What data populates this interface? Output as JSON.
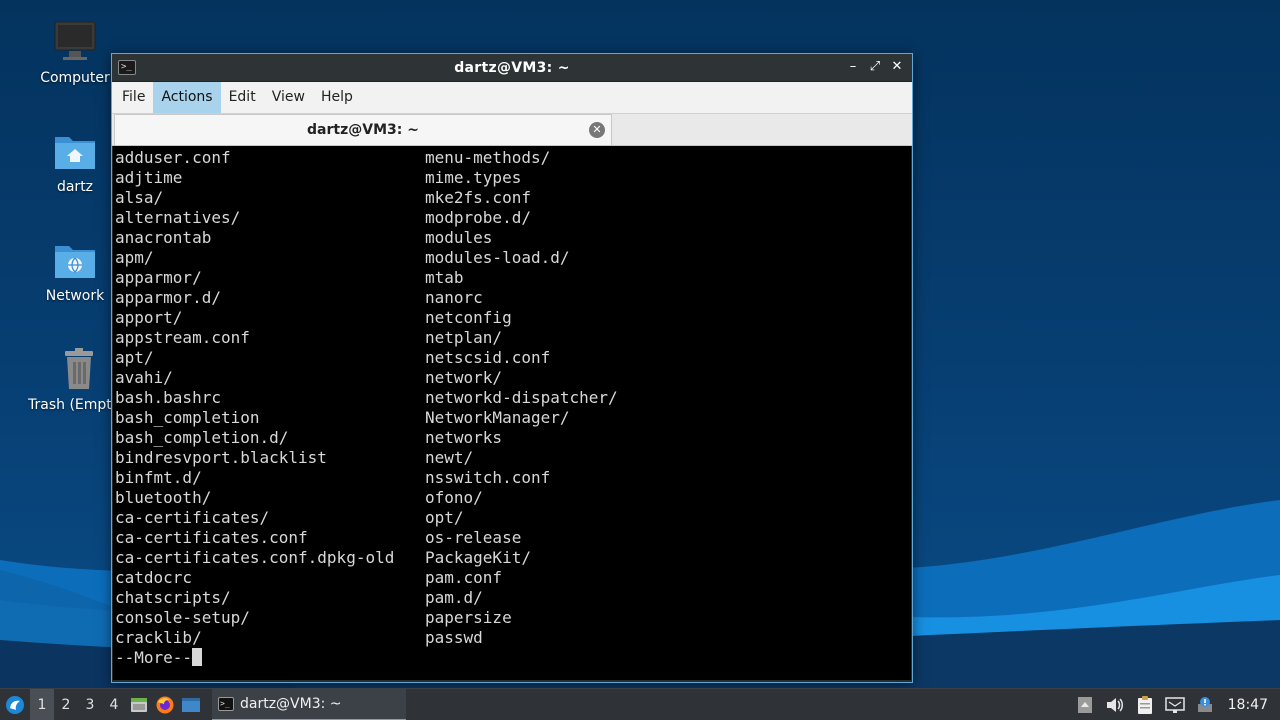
{
  "desktop": {
    "icons": [
      {
        "label": "Computer",
        "icon": "computer-icon"
      },
      {
        "label": "dartz",
        "icon": "home-folder-icon"
      },
      {
        "label": "Network",
        "icon": "network-folder-icon"
      },
      {
        "label": "Trash (Empty)",
        "icon": "trash-icon"
      }
    ]
  },
  "window": {
    "title": "dartz@VM3: ~",
    "controls": {
      "minimize": "–",
      "maximize": "⤢",
      "close": "✕"
    },
    "menu": [
      "File",
      "Actions",
      "Edit",
      "View",
      "Help"
    ],
    "active_menu": "Actions",
    "tab": {
      "label": "dartz@VM3: ~",
      "close": "✕"
    }
  },
  "terminal": {
    "col1": [
      "adduser.conf",
      "adjtime",
      "alsa/",
      "alternatives/",
      "anacrontab",
      "apm/",
      "apparmor/",
      "apparmor.d/",
      "apport/",
      "appstream.conf",
      "apt/",
      "avahi/",
      "bash.bashrc",
      "bash_completion",
      "bash_completion.d/",
      "bindresvport.blacklist",
      "binfmt.d/",
      "bluetooth/",
      "ca-certificates/",
      "ca-certificates.conf",
      "ca-certificates.conf.dpkg-old",
      "catdocrc",
      "chatscripts/",
      "console-setup/",
      "cracklib/"
    ],
    "col2": [
      "menu-methods/",
      "mime.types",
      "mke2fs.conf",
      "modprobe.d/",
      "modules",
      "modules-load.d/",
      "mtab",
      "nanorc",
      "netconfig",
      "netplan/",
      "netscsid.conf",
      "network/",
      "networkd-dispatcher/",
      "NetworkManager/",
      "networks",
      "newt/",
      "nsswitch.conf",
      "ofono/",
      "opt/",
      "os-release",
      "PackageKit/",
      "pam.conf",
      "pam.d/",
      "papersize",
      "passwd"
    ],
    "more_prompt": "--More--"
  },
  "taskbar": {
    "workspaces": [
      "1",
      "2",
      "3",
      "4"
    ],
    "active_workspace": "1",
    "launchers": [
      "file-manager-icon",
      "firefox-icon",
      "desktop-icon"
    ],
    "task_label": "dartz@VM3: ~",
    "tray_icons": [
      "tray-up-icon",
      "volume-icon",
      "clipboard-icon",
      "network-icon",
      "update-notifier-icon"
    ],
    "clock": "18:47"
  }
}
